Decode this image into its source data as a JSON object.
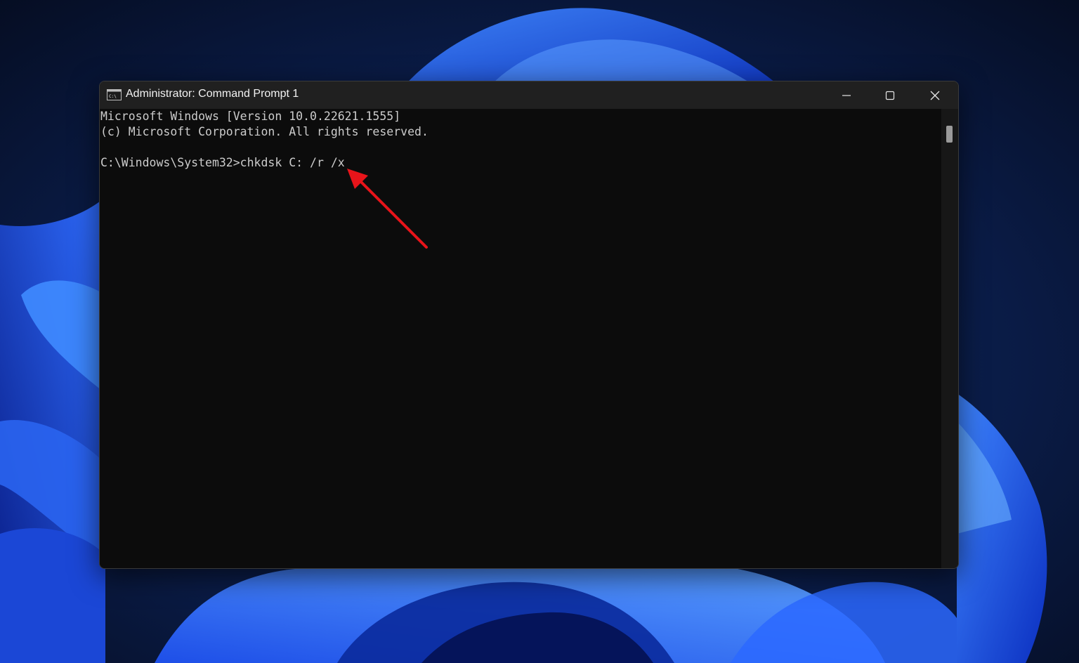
{
  "window": {
    "title": "Administrator: Command Prompt 1",
    "app_icon": "command-prompt-icon",
    "controls": {
      "minimize_icon": "minimize-icon",
      "maximize_icon": "maximize-icon",
      "close_icon": "close-icon"
    }
  },
  "console": {
    "lines": [
      "Microsoft Windows [Version 10.0.22621.1555]",
      "(c) Microsoft Corporation. All rights reserved.",
      "C:\\Windows\\System32>chkdsk C: /r /x"
    ]
  },
  "annotation": {
    "type": "arrow",
    "color": "#e8141a",
    "points_to": "command-line"
  },
  "colors": {
    "console_background": "#0c0c0c",
    "console_text": "#cccccc",
    "titlebar": "#202020",
    "wallpaper_accent": "#1f5bff"
  }
}
